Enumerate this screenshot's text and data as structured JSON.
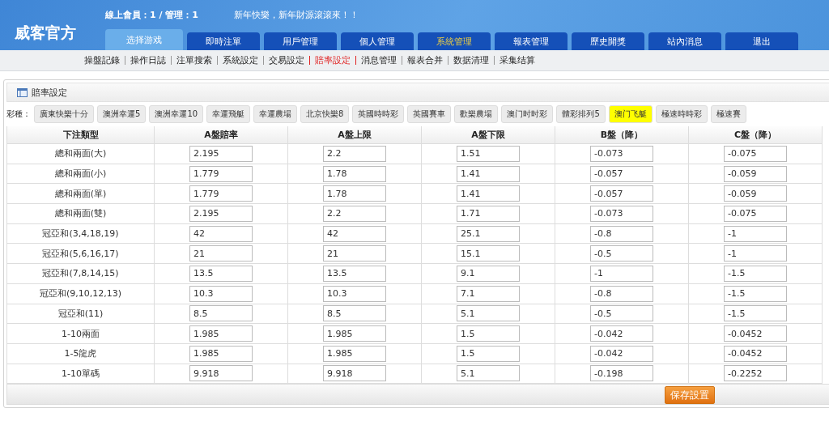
{
  "header": {
    "logo": "威客官方",
    "online": "線上會員：1 / 管理：1",
    "marquee": "新年快樂，新年財源滾滾來！！"
  },
  "nav_tabs": [
    {
      "label": "选择游戏",
      "kind": "light",
      "selected": false
    },
    {
      "label": "即時注單",
      "kind": "normal",
      "selected": false
    },
    {
      "label": "用戶管理",
      "kind": "normal",
      "selected": false
    },
    {
      "label": "個人管理",
      "kind": "normal",
      "selected": false
    },
    {
      "label": "系統管理",
      "kind": "normal",
      "selected": true
    },
    {
      "label": "報表管理",
      "kind": "normal",
      "selected": false
    },
    {
      "label": "歷史開獎",
      "kind": "normal",
      "selected": false
    },
    {
      "label": "站內消息",
      "kind": "normal",
      "selected": false
    },
    {
      "label": "退出",
      "kind": "normal",
      "selected": false
    }
  ],
  "sub_nav": [
    {
      "label": "操盤記錄",
      "selected": false
    },
    {
      "label": "操作日誌",
      "selected": false
    },
    {
      "label": "注單搜索",
      "selected": false
    },
    {
      "label": "系統設定",
      "selected": false
    },
    {
      "label": "交易設定",
      "selected": false
    },
    {
      "label": "賠率設定",
      "selected": true
    },
    {
      "label": "消息管理",
      "selected": false
    },
    {
      "label": "報表合并",
      "selected": false
    },
    {
      "label": "数据清理",
      "selected": false
    },
    {
      "label": "采集结算",
      "selected": false
    }
  ],
  "panel": {
    "title": "賠率設定",
    "lottery_label": "彩種：",
    "lotteries": [
      {
        "label": "廣東快樂十分",
        "selected": false
      },
      {
        "label": "澳洲幸運5",
        "selected": false
      },
      {
        "label": "澳洲幸運10",
        "selected": false
      },
      {
        "label": "幸運飛艇",
        "selected": false
      },
      {
        "label": "幸運農場",
        "selected": false
      },
      {
        "label": "北京快樂8",
        "selected": false
      },
      {
        "label": "英國時時彩",
        "selected": false
      },
      {
        "label": "英國賽車",
        "selected": false
      },
      {
        "label": "歡樂農場",
        "selected": false
      },
      {
        "label": "澳门时时彩",
        "selected": false
      },
      {
        "label": "體彩排列5",
        "selected": false
      },
      {
        "label": "澳门飞艇",
        "selected": true
      },
      {
        "label": "極速時時彩",
        "selected": false
      },
      {
        "label": "極速賽",
        "selected": false
      }
    ],
    "columns": [
      "下注類型",
      "A盤賠率",
      "A盤上限",
      "A盤下限",
      "B盤（降）",
      "C盤（降）"
    ],
    "rows": [
      [
        "總和兩面(大)",
        "2.195",
        "2.2",
        "1.51",
        "-0.073",
        "-0.075"
      ],
      [
        "總和兩面(小)",
        "1.779",
        "1.78",
        "1.41",
        "-0.057",
        "-0.059"
      ],
      [
        "總和兩面(單)",
        "1.779",
        "1.78",
        "1.41",
        "-0.057",
        "-0.059"
      ],
      [
        "總和兩面(雙)",
        "2.195",
        "2.2",
        "1.71",
        "-0.073",
        "-0.075"
      ],
      [
        "冠亞和(3,4,18,19)",
        "42",
        "42",
        "25.1",
        "-0.8",
        "-1"
      ],
      [
        "冠亞和(5,6,16,17)",
        "21",
        "21",
        "15.1",
        "-0.5",
        "-1"
      ],
      [
        "冠亞和(7,8,14,15)",
        "13.5",
        "13.5",
        "9.1",
        "-1",
        "-1.5"
      ],
      [
        "冠亞和(9,10,12,13)",
        "10.3",
        "10.3",
        "7.1",
        "-0.8",
        "-1.5"
      ],
      [
        "冠亞和(11)",
        "8.5",
        "8.5",
        "5.1",
        "-0.5",
        "-1.5"
      ],
      [
        "1-10兩面",
        "1.985",
        "1.985",
        "1.5",
        "-0.042",
        "-0.0452"
      ],
      [
        "1-5龍虎",
        "1.985",
        "1.985",
        "1.5",
        "-0.042",
        "-0.0452"
      ],
      [
        "1-10單碼",
        "9.918",
        "9.918",
        "5.1",
        "-0.198",
        "-0.2252"
      ]
    ],
    "save_button": "保存設置"
  }
}
